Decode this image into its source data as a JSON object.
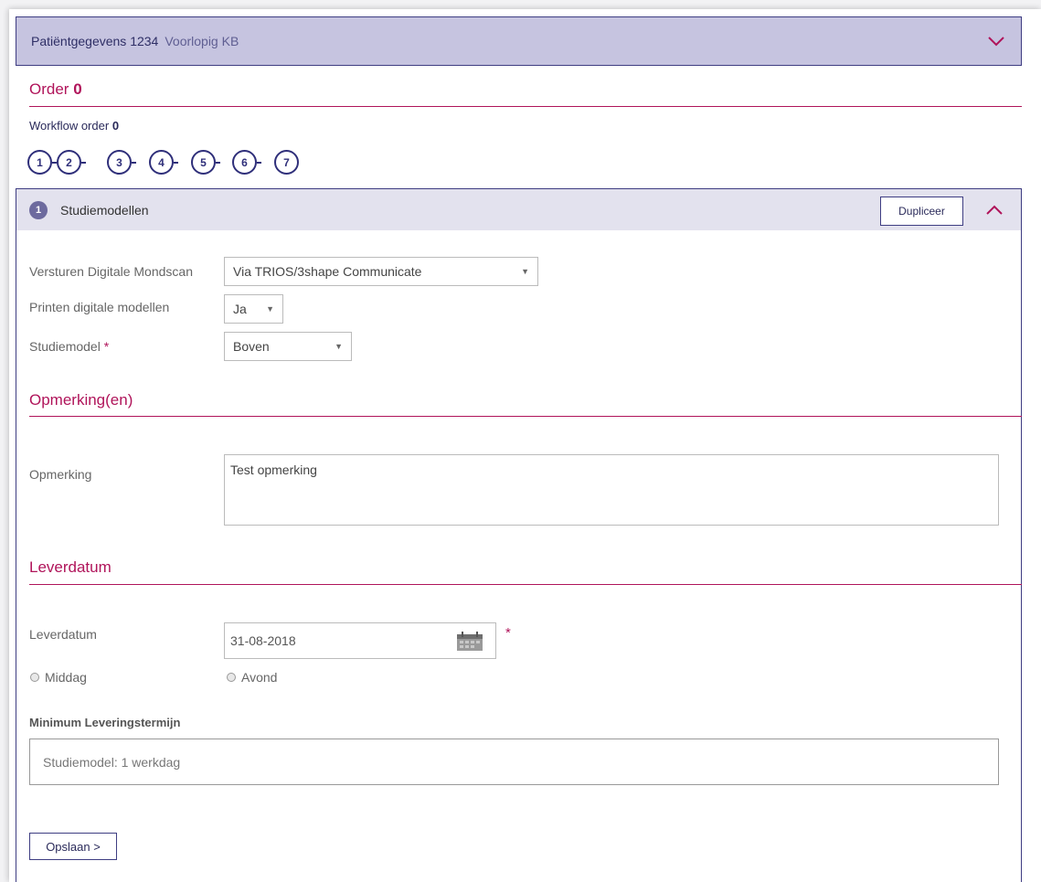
{
  "patient": {
    "title": "Patiëntgegevens 1234",
    "subtitle": "Voorlopig KB"
  },
  "order": {
    "label": "Order",
    "number": "0"
  },
  "workflow": {
    "label": "Workflow order",
    "number": "0",
    "steps": [
      "1",
      "2",
      "3",
      "4",
      "5",
      "6",
      "7"
    ]
  },
  "section": {
    "badge": "1",
    "title": "Studiemodellen",
    "duplicate_label": "Dupliceer"
  },
  "fields": {
    "mondscan": {
      "label": "Versturen Digitale Mondscan",
      "value": "Via TRIOS/3shape Communicate"
    },
    "printen": {
      "label": "Printen digitale modellen",
      "value": "Ja"
    },
    "studiemodel": {
      "label": "Studiemodel",
      "required": "*",
      "value": "Boven"
    }
  },
  "opmerking_section": {
    "title": "Opmerking(en)",
    "label": "Opmerking",
    "value": "Test opmerking"
  },
  "leverdatum_section": {
    "title": "Leverdatum",
    "label": "Leverdatum",
    "value": "31-08-2018",
    "required": "*",
    "radio_middag": "Middag",
    "radio_avond": "Avond"
  },
  "minimum": {
    "label": "Minimum Leveringstermijn",
    "value": "Studiemodel: 1 werkdag"
  },
  "save": {
    "label": "Opslaan >"
  },
  "colors": {
    "accent": "#b0145a",
    "primary": "#3e3d82",
    "header_bg": "#c6c4e0",
    "section_bg": "#e3e2ee"
  }
}
